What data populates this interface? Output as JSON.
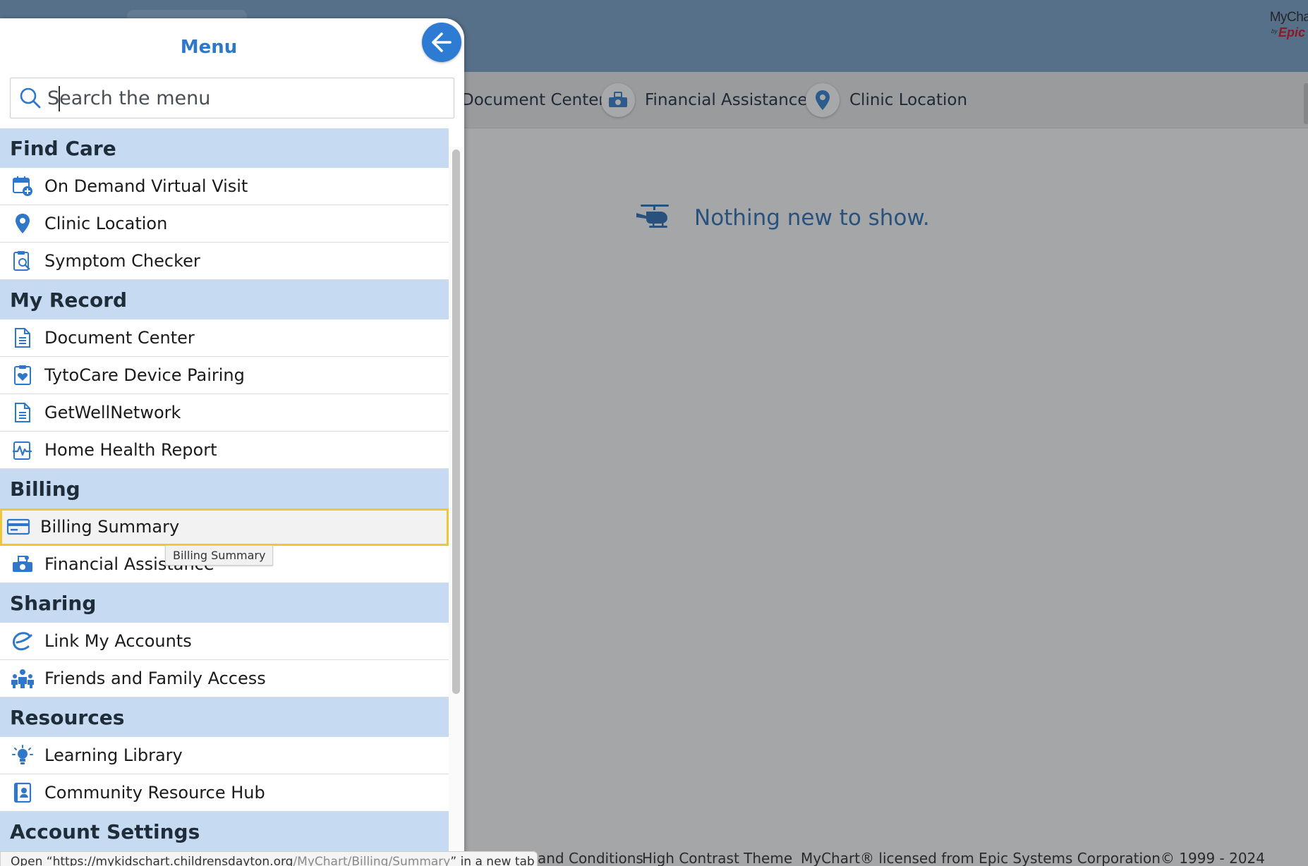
{
  "header": {
    "brand_top": "MyChart",
    "brand_by": "by",
    "brand_epic": "Epic"
  },
  "shortcuts": [
    {
      "label": "Document Center",
      "icon": "document-icon"
    },
    {
      "label": "Financial Assistance",
      "icon": "financial-assistance-icon"
    },
    {
      "label": "Clinic Location",
      "icon": "map-pin-icon"
    }
  ],
  "main": {
    "empty_message": "Nothing new to show.",
    "empty_icon": "helicopter-icon"
  },
  "footer": {
    "links_fragment": "and Conditions",
    "high_contrast": "High Contrast Theme",
    "license": "MyChart® licensed from Epic Systems Corporation© 1999 - 2024"
  },
  "menu": {
    "title": "Menu",
    "back_icon": "arrow-left-icon",
    "search_placeholder": "Search the menu",
    "sections": [
      {
        "title": "Find Care",
        "items": [
          {
            "label": "On Demand Virtual Visit",
            "icon": "calendar-plus-icon"
          },
          {
            "label": "Clinic Location",
            "icon": "map-pin-icon"
          },
          {
            "label": "Symptom Checker",
            "icon": "clipboard-search-icon"
          }
        ]
      },
      {
        "title": "My Record",
        "items": [
          {
            "label": "Document Center",
            "icon": "document-icon"
          },
          {
            "label": "TytoCare Device Pairing",
            "icon": "clipboard-heart-icon"
          },
          {
            "label": "GetWellNetwork",
            "icon": "document-icon"
          },
          {
            "label": "Home Health Report",
            "icon": "pulse-chart-icon"
          }
        ]
      },
      {
        "title": "Billing",
        "items": [
          {
            "label": "Billing Summary",
            "icon": "credit-card-icon"
          },
          {
            "label": "Financial Assistance",
            "icon": "financial-assistance-icon"
          }
        ]
      },
      {
        "title": "Sharing",
        "items": [
          {
            "label": "Link My Accounts",
            "icon": "link-accounts-icon"
          },
          {
            "label": "Friends and Family Access",
            "icon": "family-icon"
          }
        ]
      },
      {
        "title": "Resources",
        "items": [
          {
            "label": "Learning Library",
            "icon": "lightbulb-icon"
          },
          {
            "label": "Community Resource Hub",
            "icon": "community-hub-icon"
          }
        ]
      },
      {
        "title": "Account Settings",
        "items": []
      }
    ],
    "hovered_item": "Billing Summary",
    "tooltip": "Billing Summary"
  },
  "status_bar": {
    "prefix": "Open “https://mykidschart.childrensdayton.org",
    "path": "/MyChart/Billing/Summary",
    "suffix": "” in a new tab"
  }
}
